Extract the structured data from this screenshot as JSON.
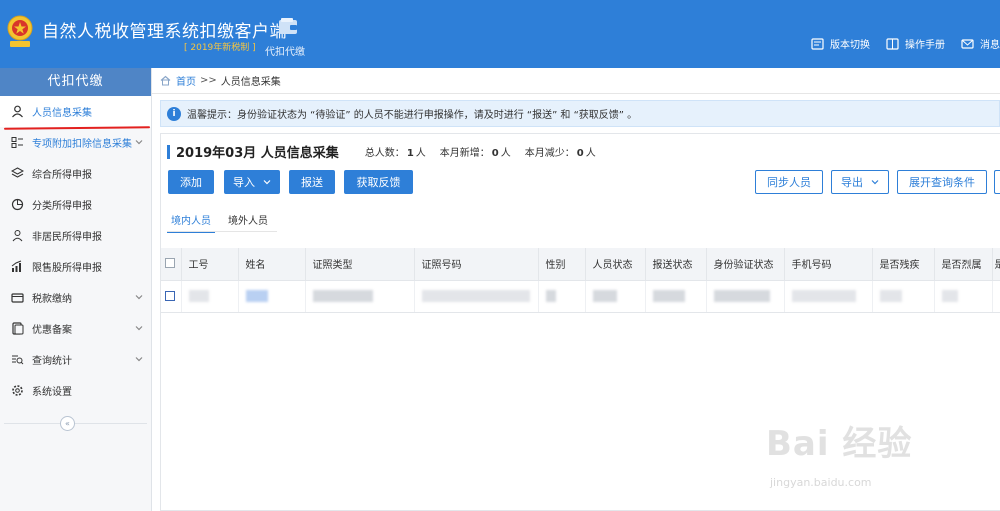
{
  "header": {
    "app_title": "自然人税收管理系统扣缴客户端",
    "app_subtitle": "[ 2019年新税制 ]",
    "module_label": "代扣代缴",
    "links": [
      {
        "label": "版本切换",
        "icon": "switch-icon"
      },
      {
        "label": "操作手册",
        "icon": "book-icon"
      },
      {
        "label": "消息",
        "icon": "mail-icon"
      }
    ]
  },
  "sidebar": {
    "title": "代扣代缴",
    "items": [
      {
        "label": "人员信息采集",
        "icon": "person-icon",
        "active": true,
        "expandable": false
      },
      {
        "label": "专项附加扣除信息采集",
        "icon": "list-icon",
        "active": false,
        "expandable": true
      },
      {
        "label": "综合所得申报",
        "icon": "layers-icon",
        "active": false,
        "expandable": false
      },
      {
        "label": "分类所得申报",
        "icon": "pie-icon",
        "active": false,
        "expandable": false
      },
      {
        "label": "非居民所得申报",
        "icon": "person-outline-icon",
        "active": false,
        "expandable": false
      },
      {
        "label": "限售股所得申报",
        "icon": "bar-chart-icon",
        "active": false,
        "expandable": false
      },
      {
        "label": "税款缴纳",
        "icon": "wallet-icon",
        "active": false,
        "expandable": true
      },
      {
        "label": "优惠备案",
        "icon": "document-icon",
        "active": false,
        "expandable": true
      },
      {
        "label": "查询统计",
        "icon": "query-icon",
        "active": false,
        "expandable": true
      },
      {
        "label": "系统设置",
        "icon": "gear-icon",
        "active": false,
        "expandable": false
      }
    ],
    "collapse_label": "«"
  },
  "breadcrumb": {
    "home": "首页",
    "separator": ">>",
    "current": "人员信息采集"
  },
  "tip": {
    "text": "温馨提示：身份验证状态为 “待验证” 的人员不能进行申报操作，请及时进行 “报送” 和 “获取反馈” 。"
  },
  "panel": {
    "title": "2019年03月  人员信息采集",
    "stats": [
      {
        "prefix": "总人数：",
        "value": "1",
        "unit": "人"
      },
      {
        "prefix": "本月新增：",
        "value": "0",
        "unit": "人"
      },
      {
        "prefix": "本月减少：",
        "value": "0",
        "unit": "人"
      }
    ],
    "buttons": {
      "add": "添加",
      "import": "导入",
      "submit": "报送",
      "feedback": "获取反馈",
      "sync": "同步人员",
      "export": "导出",
      "expand_query": "展开查询条件"
    },
    "tabs": [
      {
        "label": "境内人员",
        "active": true
      },
      {
        "label": "境外人员",
        "active": false
      }
    ],
    "table": {
      "columns": [
        "工号",
        "姓名",
        "证照类型",
        "证照号码",
        "性别",
        "人员状态",
        "报送状态",
        "身份验证状态",
        "手机号码",
        "是否残疾",
        "是否烈属",
        "是"
      ]
    }
  },
  "watermark": {
    "logo": "Bai 经验",
    "site": "jingyan.baidu.com"
  },
  "colors": {
    "brand_blue": "#2e7fd8",
    "sidebar_title": "#4f85c6",
    "annotation_red": "#e3211f"
  }
}
